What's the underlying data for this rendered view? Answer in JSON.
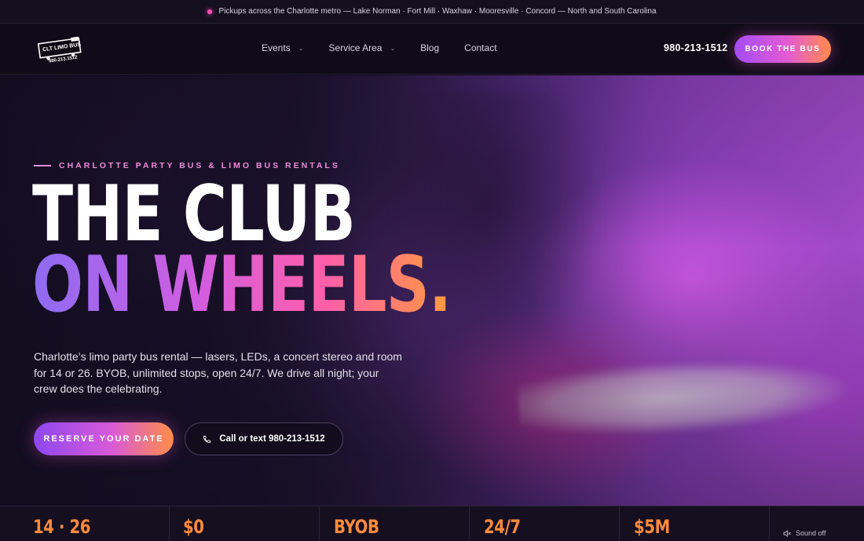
{
  "announcement": {
    "text": "Pickups across the Charlotte metro — Lake Norman · Fort Mill · Waxhaw · Mooresville · Concord — North and South Carolina"
  },
  "header": {
    "logo": {
      "line1": "CLT LIMO BUS",
      "line2": "980.213.1512"
    },
    "nav": [
      {
        "label": "Events",
        "has_dropdown": true
      },
      {
        "label": "Service Area",
        "has_dropdown": true
      },
      {
        "label": "Blog",
        "has_dropdown": false
      },
      {
        "label": "Contact",
        "has_dropdown": false
      }
    ],
    "phone": "980-213-1512",
    "book_label": "BOOK THE BUS"
  },
  "hero": {
    "eyebrow": "CHARLOTTE PARTY BUS & LIMO BUS RENTALS",
    "headline_line1": "THE CLUB",
    "headline_line2": "ON WHEELS.",
    "lede": "Charlotte’s limo party bus rental — lasers, LEDs, a concert stereo and room for 14 or 26. BYOB, unlimited stops, open 24/7. We drive all night; your crew does the celebrating.",
    "cta_primary": "RESERVE YOUR DATE",
    "cta_secondary": "Call or text 980-213-1512"
  },
  "stats": [
    "14 · 26",
    "$0",
    "BYOB",
    "24/7",
    "$5M"
  ],
  "sound_toggle": "Sound off",
  "colors": {
    "accent_pink": "#f08ad6",
    "accent_orange": "#ff8a3c",
    "gradient_purple": "#8e47f0",
    "background": "#120d1c"
  }
}
